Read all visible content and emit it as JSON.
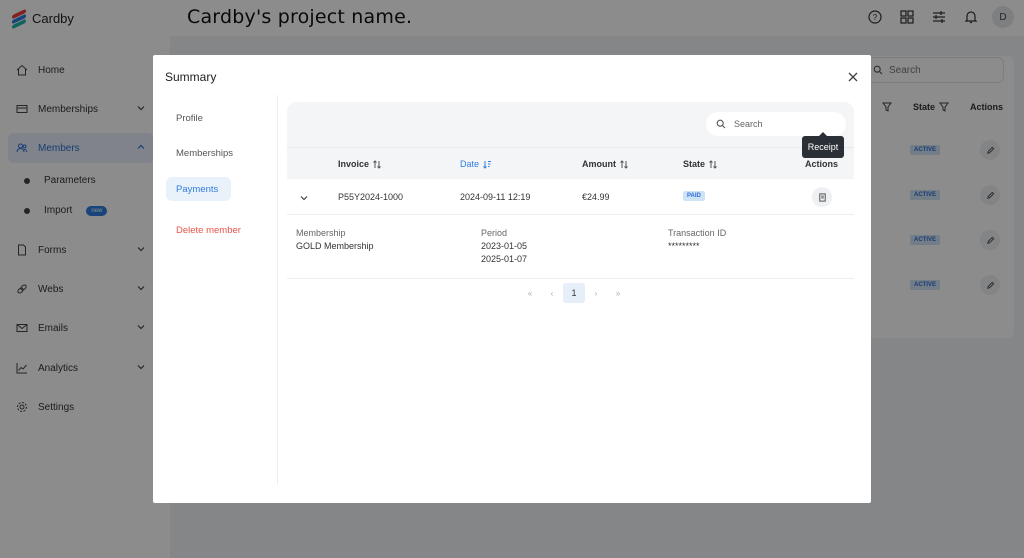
{
  "app": {
    "logo_text": "Cardby",
    "project_title": "Cardby's project name.",
    "avatar_initial": "D"
  },
  "sidebar": {
    "items": [
      {
        "label": "Home"
      },
      {
        "label": "Memberships"
      },
      {
        "label": "Members"
      },
      {
        "label": "Forms"
      },
      {
        "label": "Webs"
      },
      {
        "label": "Emails"
      },
      {
        "label": "Analytics"
      },
      {
        "label": "Settings"
      }
    ],
    "sub": [
      {
        "label": "Parameters"
      },
      {
        "label": "Import",
        "badge": "new"
      }
    ]
  },
  "background": {
    "search_placeholder": "Search",
    "state_header": "State",
    "actions_header": "Actions",
    "row_state": "ACTIVE"
  },
  "modal": {
    "title": "Summary",
    "nav": [
      {
        "label": "Profile"
      },
      {
        "label": "Memberships"
      },
      {
        "label": "Payments"
      },
      {
        "label": "Delete member"
      }
    ],
    "search_placeholder": "Search",
    "columns": {
      "invoice": "Invoice",
      "date": "Date",
      "amount": "Amount",
      "state": "State",
      "actions": "Actions"
    },
    "row": {
      "invoice": "P55Y2024-1000",
      "date": "2024-09-11 12:19",
      "amount": "€24.99",
      "state": "PAID"
    },
    "tooltip": "Receipt",
    "detail": {
      "membership_label": "Membership",
      "membership_value": "GOLD Membership",
      "period_label": "Period",
      "period_start": "2023-01-05",
      "period_end": "2025-01-07",
      "transaction_label": "Transaction ID",
      "transaction_value": "*********"
    },
    "pagination": {
      "first": "«",
      "prev": "‹",
      "current": "1",
      "next": "›",
      "last": "»"
    }
  },
  "colors": {
    "accent": "#2f7de1",
    "danger": "#e9544b",
    "badge_bg": "#cfe3f7"
  }
}
